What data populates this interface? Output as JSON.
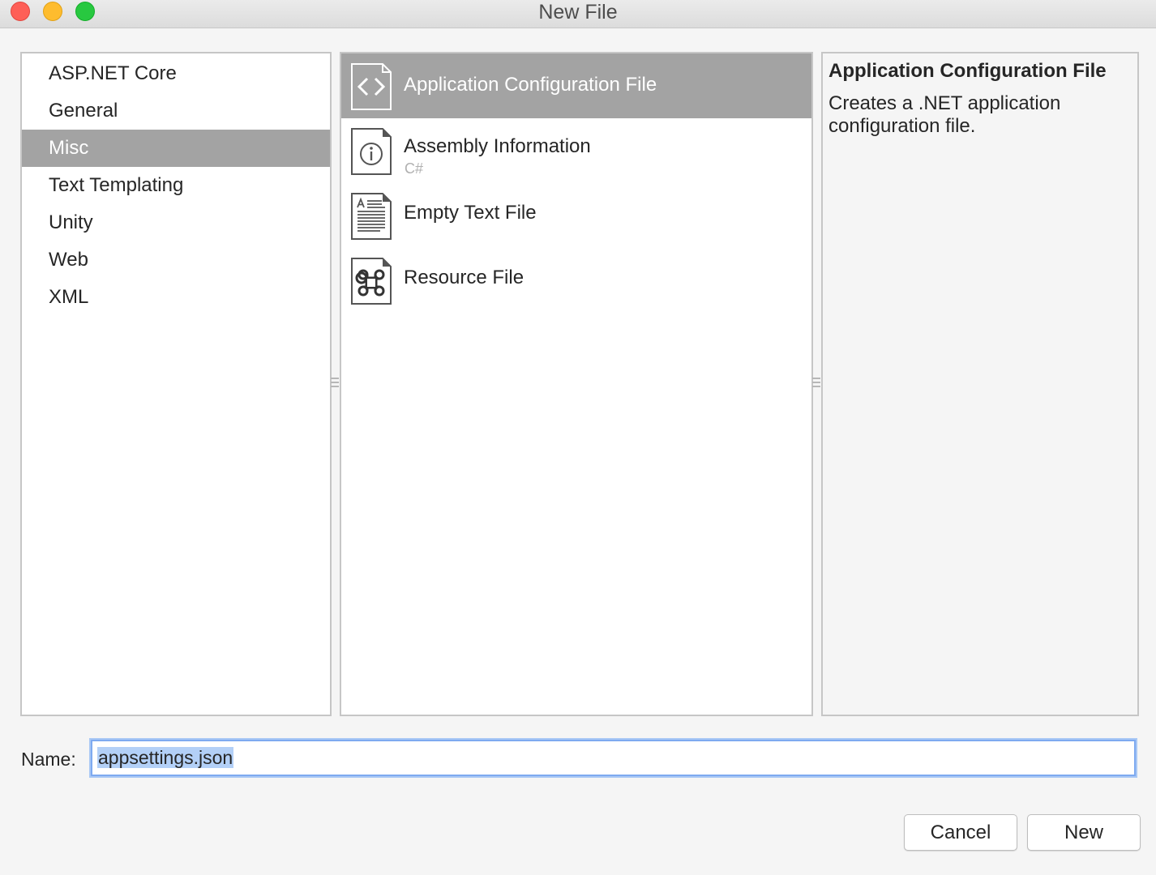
{
  "window": {
    "title": "New File"
  },
  "categories": {
    "items": [
      {
        "label": "ASP.NET Core"
      },
      {
        "label": "General"
      },
      {
        "label": "Misc",
        "selected": true
      },
      {
        "label": "Text Templating"
      },
      {
        "label": "Unity"
      },
      {
        "label": "Web"
      },
      {
        "label": "XML"
      }
    ]
  },
  "templates": {
    "items": [
      {
        "label": "Application Configuration File",
        "icon": "code-brackets-icon",
        "selected": true
      },
      {
        "label": "Assembly Information",
        "sublabel": "C#",
        "icon": "info-icon"
      },
      {
        "label": "Empty Text File",
        "icon": "text-document-icon"
      },
      {
        "label": "Resource File",
        "icon": "command-icon"
      }
    ]
  },
  "description": {
    "title": "Application Configuration File",
    "body": "Creates a .NET application configuration file."
  },
  "name_field": {
    "label": "Name:",
    "value": "appsettings.json"
  },
  "buttons": {
    "cancel": "Cancel",
    "new": "New"
  },
  "colors": {
    "selection": "#a3a3a3",
    "focus_ring": "#7eaaf0",
    "text_selection": "#b3d0f7",
    "traffic_close": "#fe5f57",
    "traffic_minimize": "#febc2e",
    "traffic_maximize": "#28c840"
  }
}
